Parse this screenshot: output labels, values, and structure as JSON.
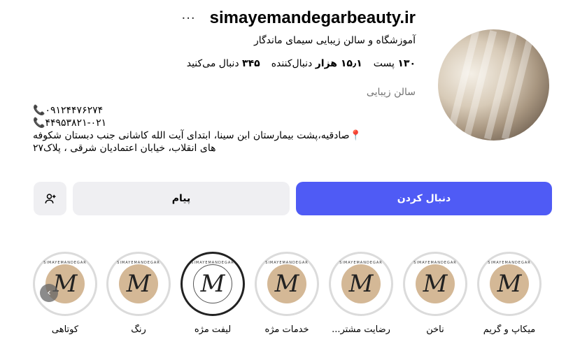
{
  "profile": {
    "username": "simayemandegarbeauty.ir",
    "full_name": "آموزشگاه و سالن زیبایی سیمای ماندگار",
    "category": "سالن زیبایی",
    "stats": {
      "posts": "۱۳۰",
      "posts_label": "پست",
      "followers": "۱۵٫۱ هزار",
      "followers_label": "دنبال‌کننده",
      "following": "۳۴۵",
      "following_label": "دنبال می‌کنید"
    },
    "bio": {
      "phone1": "۰۹۱۲۴۴۷۶۲۷۴📞",
      "phone2": "۴۴۹۵۳۸۲۱-۰۲۱📞",
      "address_line1": "📍صادقیه،پشت بیمارستان ابن سینا، ابتدای آیت الله کاشانی جنب دبستان شکوفه",
      "address_line2": "های انقلاب، خیابان اعتمادیان شرقی ، پلاک۲۷"
    }
  },
  "actions": {
    "follow_label": "دنبال کردن",
    "message_label": "پیام"
  },
  "highlights": [
    {
      "label": "میکاپ و گریم"
    },
    {
      "label": "ناخن"
    },
    {
      "label": "رضایت مشتر..."
    },
    {
      "label": "خدمات مژه"
    },
    {
      "label": "لیفت مژه"
    },
    {
      "label": "رنگ"
    },
    {
      "label": "کوتاهی"
    }
  ],
  "highlight_logo_text": "SIMAYEMANDEGAR",
  "colors": {
    "follow_button": "#4f5bf5",
    "secondary_button": "#efeff2",
    "highlight_fill": "#d4b896",
    "muted_text": "#737373"
  }
}
